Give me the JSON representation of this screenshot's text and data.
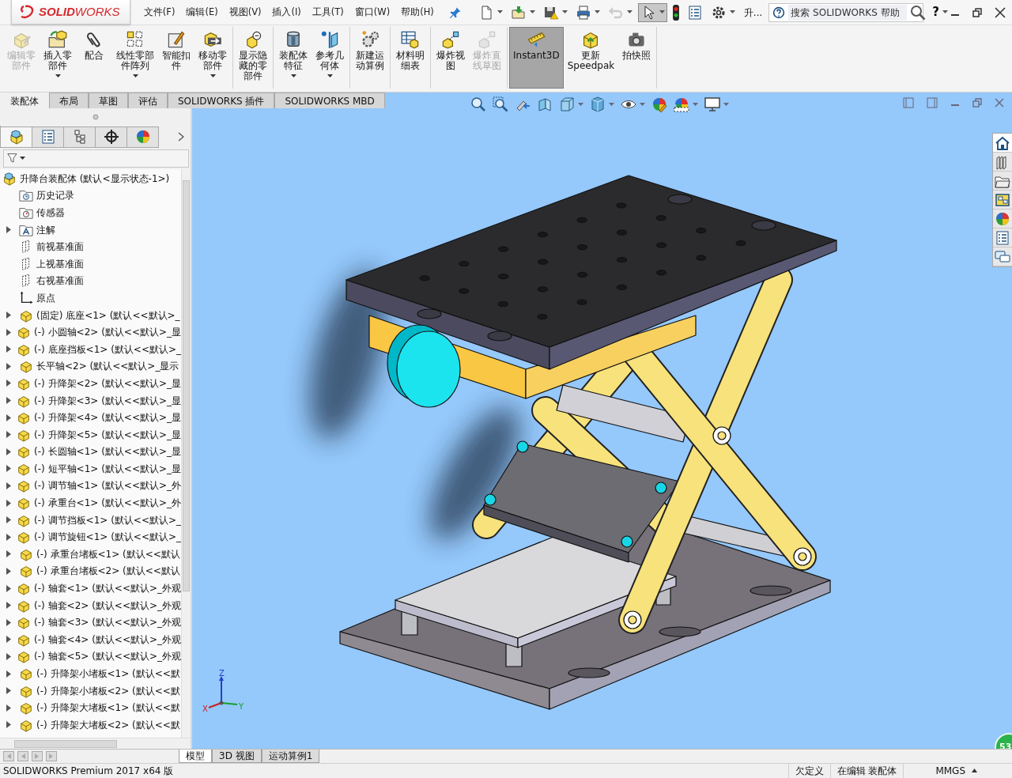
{
  "title_bar": {
    "logo": "**SOLID**WORKS",
    "menus": [
      "文件(F)",
      "编辑(E)",
      "视图(V)",
      "插入(I)",
      "工具(T)",
      "窗口(W)",
      "帮助(H)"
    ],
    "quick_tools": [
      {
        "kind": "new",
        "dropdown": true,
        "disabled": false,
        "selected": false
      },
      {
        "kind": "open",
        "dropdown": true,
        "disabled": false,
        "selected": false
      },
      {
        "kind": "save",
        "dropdown": true,
        "disabled": false,
        "selected": false
      },
      {
        "kind": "print",
        "dropdown": true,
        "disabled": false,
        "selected": false
      },
      {
        "kind": "undo",
        "dropdown": true,
        "disabled": true,
        "selected": false
      },
      {
        "kind": "select",
        "dropdown": true,
        "disabled": false,
        "selected": true
      },
      {
        "kind": "rebuild",
        "dropdown": false,
        "disabled": false,
        "selected": false
      },
      {
        "kind": "properties",
        "dropdown": false,
        "disabled": false,
        "selected": false
      },
      {
        "kind": "options",
        "dropdown": true,
        "disabled": false,
        "selected": false
      }
    ],
    "overflow": "升...",
    "search": {
      "placeholder": "搜索 SOLIDWORKS 帮助"
    },
    "help": "?"
  },
  "command_manager": {
    "groups": [
      [
        {
          "kind": "edit-part",
          "label": "编辑零部件",
          "dropdown": false,
          "disabled": true,
          "selected": false
        },
        {
          "kind": "insert-part",
          "label": "插入零部件",
          "dropdown": true,
          "disabled": false,
          "selected": false
        },
        {
          "kind": "mate",
          "label": "配合",
          "dropdown": false,
          "disabled": false,
          "selected": false
        },
        {
          "kind": "pattern",
          "label": "线性零部件阵列",
          "dropdown": true,
          "disabled": false,
          "selected": false
        },
        {
          "kind": "fastener",
          "label": "智能扣件",
          "dropdown": false,
          "disabled": false,
          "selected": false
        },
        {
          "kind": "move",
          "label": "移动零部件",
          "dropdown": true,
          "disabled": false,
          "selected": false
        }
      ],
      [
        {
          "kind": "show-hidden",
          "label": "显示隐藏的零部件",
          "dropdown": false,
          "disabled": false,
          "selected": false
        }
      ],
      [
        {
          "kind": "assembly-feature",
          "label": "装配体特征",
          "dropdown": true,
          "disabled": false,
          "selected": false
        },
        {
          "kind": "reference",
          "label": "参考几何体",
          "dropdown": true,
          "disabled": false,
          "selected": false
        }
      ],
      [
        {
          "kind": "motion",
          "label": "新建运动算例",
          "dropdown": false,
          "disabled": false,
          "selected": false
        }
      ],
      [
        {
          "kind": "bom",
          "label": "材料明细表",
          "dropdown": false,
          "disabled": false,
          "selected": false
        }
      ],
      [
        {
          "kind": "explode",
          "label": "爆炸视图",
          "dropdown": false,
          "disabled": false,
          "selected": false
        },
        {
          "kind": "explode-sketch",
          "label": "爆炸直线草图",
          "dropdown": false,
          "disabled": true,
          "selected": false
        }
      ],
      [
        {
          "kind": "instant3d",
          "label": "Instant3D",
          "dropdown": false,
          "disabled": false,
          "selected": true
        },
        {
          "kind": "speedpak",
          "label": "更新 Speedpak",
          "dropdown": false,
          "disabled": false,
          "selected": false
        },
        {
          "kind": "snapshot",
          "label": "拍快照",
          "dropdown": false,
          "disabled": false,
          "selected": false
        }
      ]
    ],
    "tabs": [
      {
        "label": "装配体",
        "selected": true
      },
      {
        "label": "布局",
        "selected": false
      },
      {
        "label": "草图",
        "selected": false
      },
      {
        "label": "评估",
        "selected": false
      },
      {
        "label": "SOLIDWORKS 插件",
        "selected": false
      },
      {
        "label": "SOLIDWORKS MBD",
        "selected": false
      }
    ]
  },
  "feature_manager": {
    "tabs": [
      {
        "kind": "feature",
        "selected": true
      },
      {
        "kind": "property",
        "selected": false
      },
      {
        "kind": "configuration",
        "selected": false
      },
      {
        "kind": "dimxpert",
        "selected": false
      },
      {
        "kind": "display",
        "selected": false
      }
    ],
    "tree": {
      "label": "升降台装配体 (默认<显示状态-1>)",
      "kind": "assembly",
      "children": [
        {
          "label": "历史记录",
          "kind": "history",
          "expandable": false
        },
        {
          "label": "传感器",
          "kind": "sensor",
          "expandable": false
        },
        {
          "label": "注解",
          "kind": "annotation",
          "expandable": true
        },
        {
          "label": "前视基准面",
          "kind": "plane",
          "expandable": false
        },
        {
          "label": "上视基准面",
          "kind": "plane",
          "expandable": false
        },
        {
          "label": "右视基准面",
          "kind": "plane",
          "expandable": false
        },
        {
          "label": "原点",
          "kind": "origin",
          "expandable": false
        },
        {
          "label": "(固定) 底座<1> (默认<<默认>_",
          "kind": "part",
          "expandable": true
        },
        {
          "label": "(-) 小圆轴<2> (默认<<默认>_显",
          "kind": "part",
          "expandable": true
        },
        {
          "label": "(-) 底座挡板<1> (默认<<默认>_",
          "kind": "part",
          "expandable": true
        },
        {
          "label": "长平轴<2> (默认<<默认>_显示",
          "kind": "part",
          "expandable": true
        },
        {
          "label": "(-) 升降架<2> (默认<<默认>_显",
          "kind": "part",
          "expandable": true
        },
        {
          "label": "(-) 升降架<3> (默认<<默认>_显",
          "kind": "part",
          "expandable": true
        },
        {
          "label": "(-) 升降架<4> (默认<<默认>_显",
          "kind": "part",
          "expandable": true
        },
        {
          "label": "(-) 升降架<5> (默认<<默认>_显",
          "kind": "part",
          "expandable": true
        },
        {
          "label": "(-) 长圆轴<1> (默认<<默认>_显",
          "kind": "part",
          "expandable": true
        },
        {
          "label": "(-) 短平轴<1> (默认<<默认>_显",
          "kind": "part",
          "expandable": true
        },
        {
          "label": "(-) 调节轴<1> (默认<<默认>_外",
          "kind": "part",
          "expandable": true
        },
        {
          "label": "(-) 承重台<1> (默认<<默认>_外",
          "kind": "part",
          "expandable": true
        },
        {
          "label": "(-) 调节挡板<1> (默认<<默认>_",
          "kind": "part",
          "expandable": true
        },
        {
          "label": "(-) 调节旋钮<1> (默认<<默认>_",
          "kind": "part",
          "expandable": true
        },
        {
          "label": "(-) 承重台堵板<1> (默认<<默认",
          "kind": "part",
          "expandable": true
        },
        {
          "label": "(-) 承重台堵板<2> (默认<<默认",
          "kind": "part",
          "expandable": true
        },
        {
          "label": "(-) 轴套<1> (默认<<默认>_外观",
          "kind": "part",
          "expandable": true
        },
        {
          "label": "(-) 轴套<2> (默认<<默认>_外观",
          "kind": "part",
          "expandable": true
        },
        {
          "label": "(-) 轴套<3> (默认<<默认>_外观",
          "kind": "part",
          "expandable": true
        },
        {
          "label": "(-) 轴套<4> (默认<<默认>_外观",
          "kind": "part",
          "expandable": true
        },
        {
          "label": "(-) 轴套<5> (默认<<默认>_外观",
          "kind": "part",
          "expandable": true
        },
        {
          "label": "(-) 升降架小堵板<1> (默认<<默",
          "kind": "part",
          "expandable": true
        },
        {
          "label": "(-) 升降架小堵板<2> (默认<<默",
          "kind": "part",
          "expandable": true
        },
        {
          "label": "(-) 升降架大堵板<1> (默认<<默",
          "kind": "part",
          "expandable": true
        },
        {
          "label": "(-) 升降架大堵板<2> (默认<<默",
          "kind": "part",
          "expandable": true
        }
      ]
    }
  },
  "bottom_tabs": [
    {
      "label": "模型",
      "selected": true
    },
    {
      "label": "3D 视图",
      "selected": false
    },
    {
      "label": "运动算例1",
      "selected": false
    }
  ],
  "status_bar": {
    "product": "SOLIDWORKS Premium 2017 x64 版",
    "fields": [
      {
        "text": "欠定义",
        "dropdown": false
      },
      {
        "text": "在编辑 装配体",
        "dropdown": false
      },
      {
        "text": "MMGS",
        "dropdown": true
      }
    ]
  },
  "viewport": {
    "badge": "53",
    "triad": [
      "Z",
      "X",
      "Y"
    ]
  }
}
